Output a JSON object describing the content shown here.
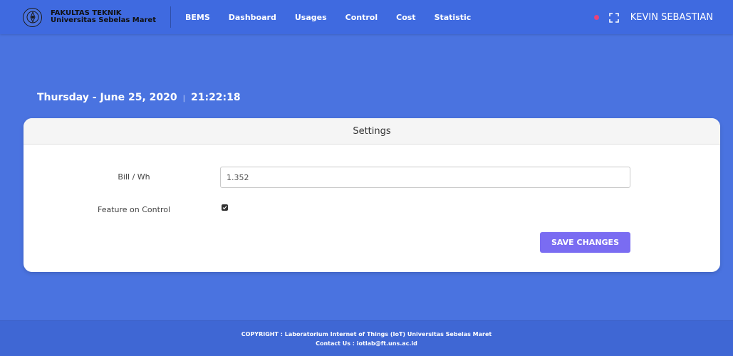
{
  "brand": {
    "line1": "FAKULTAS TEKNIK",
    "line2": "Universitas Sebelas Maret"
  },
  "nav": {
    "items": [
      {
        "label": "BEMS"
      },
      {
        "label": "Dashboard"
      },
      {
        "label": "Usages"
      },
      {
        "label": "Control"
      },
      {
        "label": "Cost"
      },
      {
        "label": "Statistic"
      }
    ]
  },
  "user": {
    "name": "KEVIN SEBASTIAN",
    "status_color": "#e8437a"
  },
  "datetime": {
    "date": "Thursday - June 25, 2020",
    "separator": "|",
    "time": "21:22:18"
  },
  "settings": {
    "title": "Settings",
    "bill_label": "Bill / Wh",
    "bill_value": "1.352",
    "feature_label": "Feature on Control",
    "feature_checked": true,
    "save_label": "SAVE CHANGES",
    "accent": "#7a6cf2"
  },
  "footer": {
    "copyright": "COPYRIGHT : Laboratorium Internet of Things (IoT) Universitas Sebelas Maret",
    "contact": "Contact Us : iotlab@ft.uns.ac.id"
  },
  "icons": [
    "university-logo-icon",
    "fullscreen-icon",
    "status-dot-icon",
    "checkbox-checked-icon"
  ]
}
